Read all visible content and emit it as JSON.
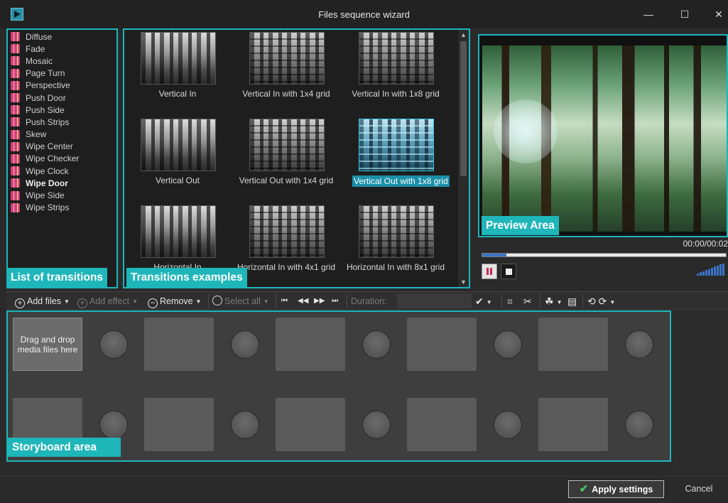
{
  "window": {
    "title": "Files sequence wizard",
    "minimize": "—",
    "maximize": "☐",
    "close": "✕"
  },
  "transitions": {
    "items": [
      "Diffuse",
      "Fade",
      "Mosaic",
      "Page Turn",
      "Perspective",
      "Push Door",
      "Push Side",
      "Push Strips",
      "Skew",
      "Wipe Center",
      "Wipe Checker",
      "Wipe Clock",
      "Wipe Door",
      "Wipe Side",
      "Wipe Strips"
    ],
    "selected": "Wipe Door",
    "callout": "List of transitions"
  },
  "examples": {
    "items": [
      {
        "label": "Vertical In"
      },
      {
        "label": "Vertical In with 1x4 grid"
      },
      {
        "label": "Vertical In with 1x8 grid"
      },
      {
        "label": "Vertical Out"
      },
      {
        "label": "Vertical Out with 1x4 grid"
      },
      {
        "label": "Vertical Out with 1x8 grid"
      },
      {
        "label": "Horizontal In"
      },
      {
        "label": "Horizontal In with 4x1 grid"
      },
      {
        "label": "Horizontal In with 8x1 grid"
      }
    ],
    "selected": "Vertical Out with 1x8 grid",
    "callout": "Transitions examples",
    "scroll_up": "▲",
    "scroll_down": "▼"
  },
  "preview": {
    "callout": "Preview Area",
    "timecode": "00:00/00:02",
    "progress_fraction": 0.1,
    "accent": "#1fb6ba"
  },
  "toolbar": {
    "add_files": "Add files",
    "add_effect": "Add effect",
    "remove": "Remove",
    "select_all": "Select all",
    "duration": "Duration:",
    "icons": [
      "first-icon",
      "previous-icon",
      "next-icon",
      "last-icon",
      "check-icon",
      "crop-icon",
      "cut-icon",
      "effects-icon",
      "copy-icon",
      "rotate-icon"
    ]
  },
  "storyboard": {
    "drop_text": "Drag and drop media files here",
    "callout": "Storyboard area"
  },
  "footer": {
    "apply": "Apply settings",
    "cancel": "Cancel"
  }
}
